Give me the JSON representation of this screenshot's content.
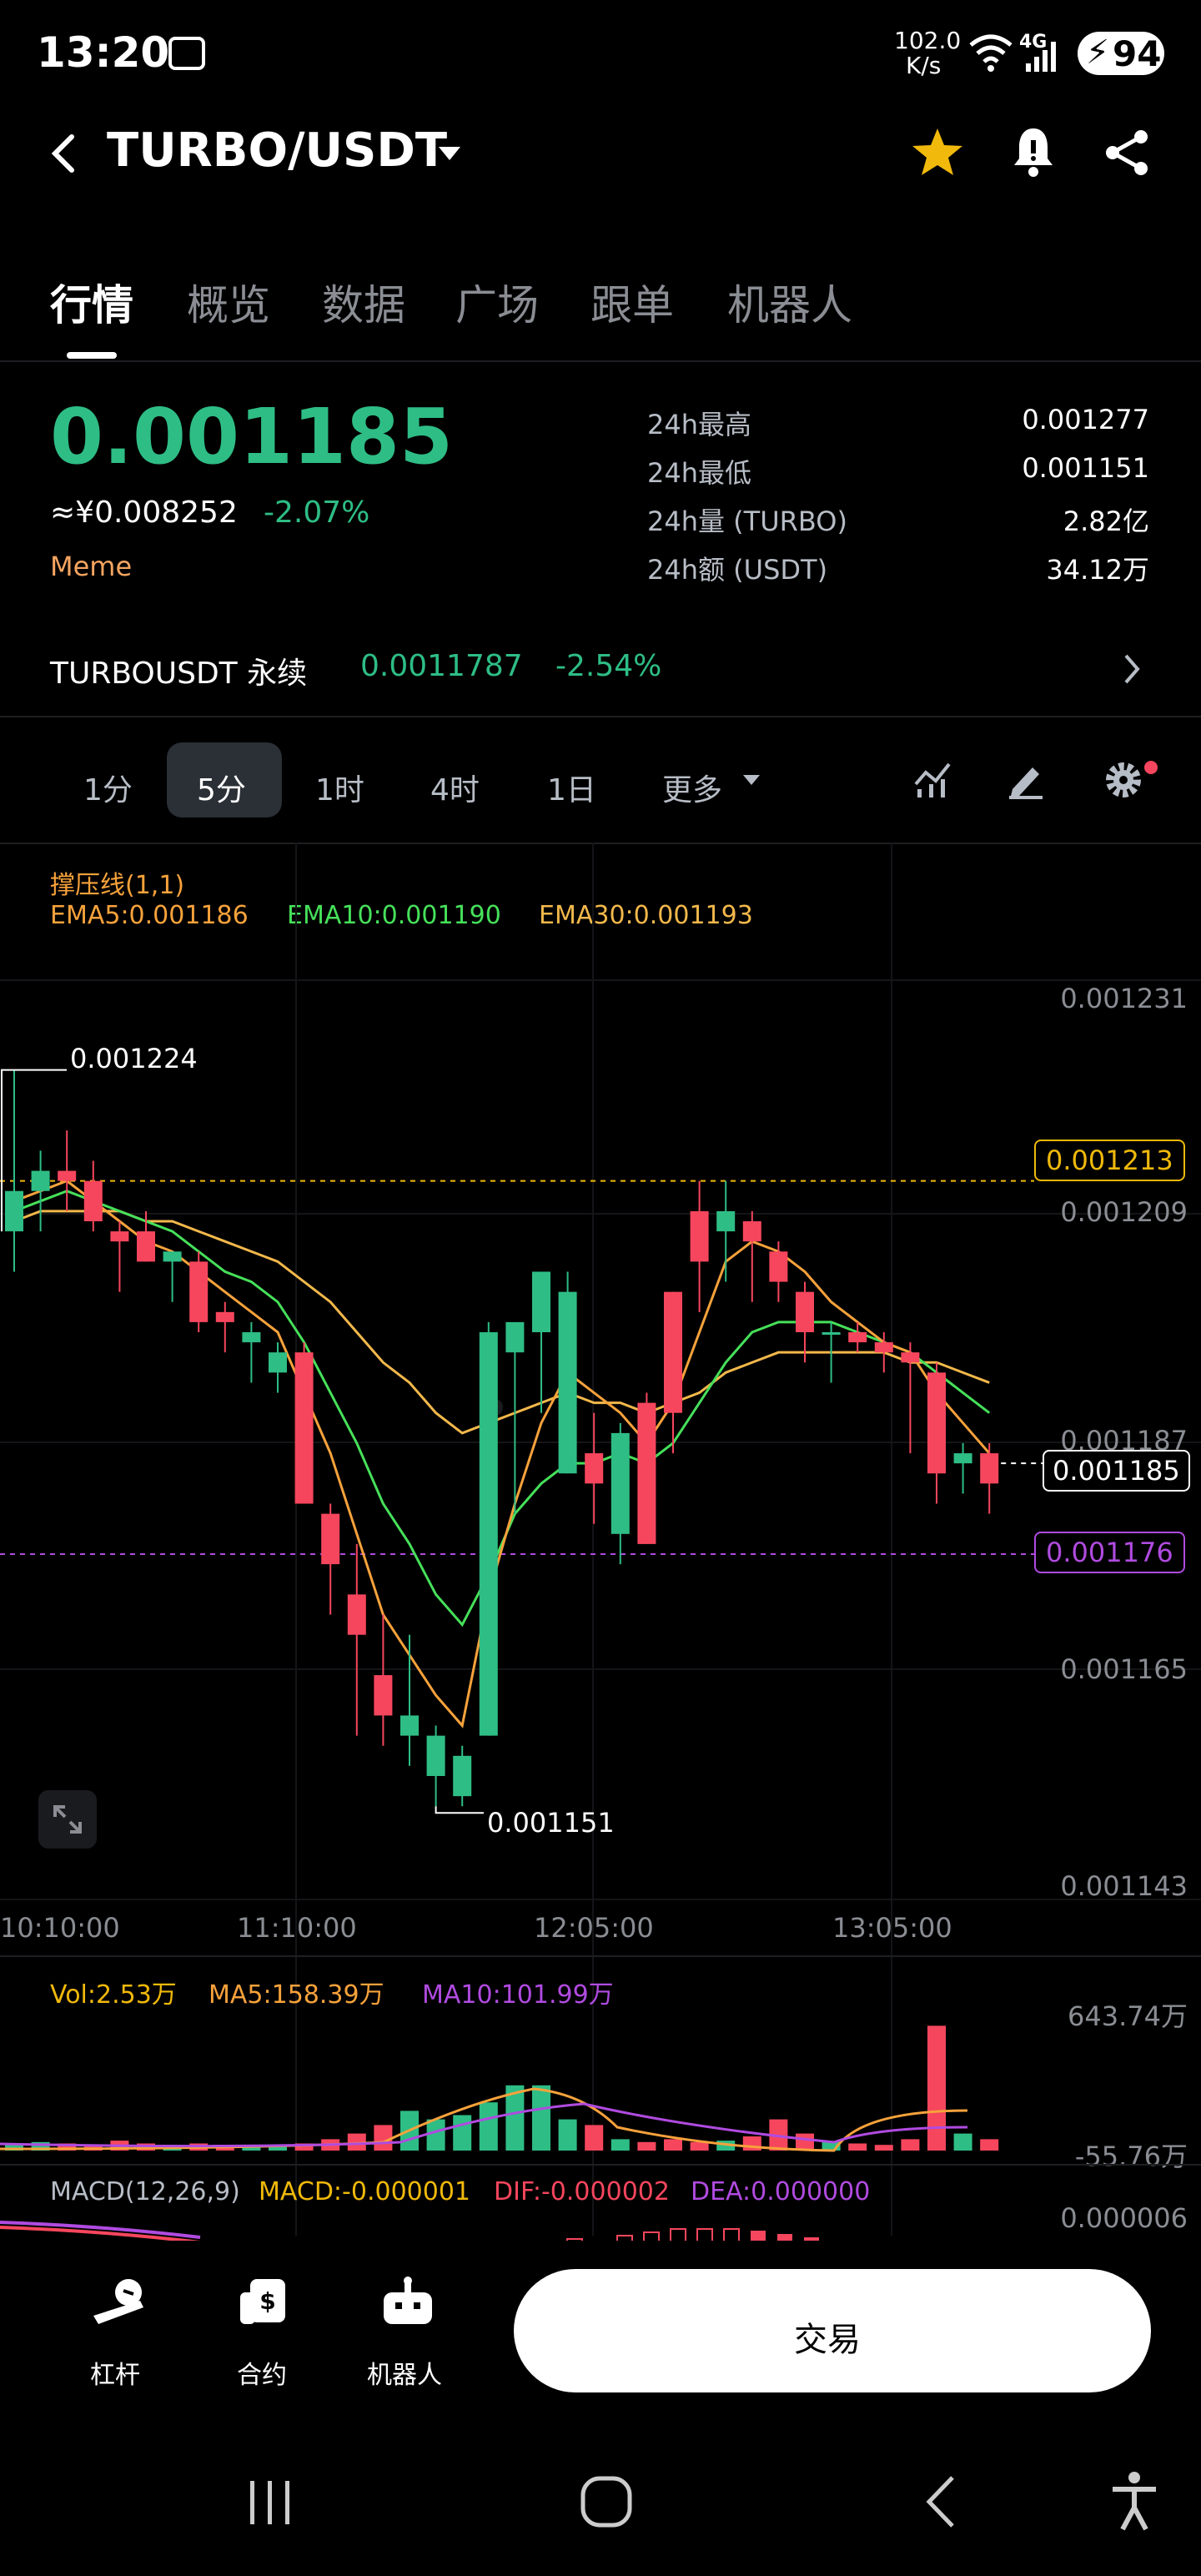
{
  "status_bar": {
    "time": "13:20",
    "net_speed_value": "102.0",
    "net_speed_unit": "K/s",
    "network": "4G",
    "battery": "94"
  },
  "header": {
    "pair": "TURBO/USDT"
  },
  "tabs": [
    "行情",
    "概览",
    "数据",
    "广场",
    "跟单",
    "机器人"
  ],
  "price": {
    "last": "0.001185",
    "cny": "≈¥0.008252",
    "change": "-2.07%",
    "tag": "Meme",
    "stats": [
      {
        "label": "24h最高",
        "value": "0.001277"
      },
      {
        "label": "24h最低",
        "value": "0.001151"
      },
      {
        "label": "24h量 (TURBO)",
        "value": "2.82亿"
      },
      {
        "label": "24h额 (USDT)",
        "value": "34.12万"
      }
    ]
  },
  "perp": {
    "name": "TURBOUSDT 永续",
    "price": "0.0011787",
    "change": "-2.54%"
  },
  "timeframes": [
    "1分",
    "5分",
    "1时",
    "4时",
    "1日",
    "更多"
  ],
  "indicators": {
    "line1": "撑压线(1,1)",
    "ema5": "EMA5:0.001186",
    "ema10": "EMA10:0.001190",
    "ema30": "EMA30:0.001193"
  },
  "chart_data": {
    "type": "candlestick",
    "y_axis_ticks": [
      "0.001231",
      "0.001209",
      "0.001187",
      "0.001165",
      "0.001143"
    ],
    "x_axis_ticks": [
      "10:10:00",
      "11:10:00",
      "12:05:00",
      "13:05:00"
    ],
    "ylim": [
      0.001143,
      0.001231
    ],
    "price_tags": {
      "resistance": "0.001213",
      "last": "0.001185",
      "support": "0.001176"
    },
    "annotations": {
      "high": "0.001224",
      "low": "0.001151"
    },
    "candles": [
      {
        "o": 0.001208,
        "h": 0.001224,
        "l": 0.001204,
        "c": 0.001212
      },
      {
        "o": 0.001212,
        "h": 0.001216,
        "l": 0.001208,
        "c": 0.001214
      },
      {
        "o": 0.001214,
        "h": 0.001218,
        "l": 0.00121,
        "c": 0.001213
      },
      {
        "o": 0.001213,
        "h": 0.001215,
        "l": 0.001208,
        "c": 0.001209
      },
      {
        "o": 0.001208,
        "h": 0.001209,
        "l": 0.001202,
        "c": 0.001207
      },
      {
        "o": 0.001208,
        "h": 0.00121,
        "l": 0.001205,
        "c": 0.001205
      },
      {
        "o": 0.001205,
        "h": 0.001206,
        "l": 0.001201,
        "c": 0.001206
      },
      {
        "o": 0.001205,
        "h": 0.001206,
        "l": 0.001198,
        "c": 0.001199
      },
      {
        "o": 0.0012,
        "h": 0.001201,
        "l": 0.001196,
        "c": 0.001199
      },
      {
        "o": 0.001197,
        "h": 0.001199,
        "l": 0.001193,
        "c": 0.001198
      },
      {
        "o": 0.001194,
        "h": 0.001197,
        "l": 0.001192,
        "c": 0.001196
      },
      {
        "o": 0.001196,
        "h": 0.001197,
        "l": 0.001188,
        "c": 0.001181
      },
      {
        "o": 0.00118,
        "h": 0.001181,
        "l": 0.00117,
        "c": 0.001175
      },
      {
        "o": 0.001172,
        "h": 0.001177,
        "l": 0.001158,
        "c": 0.001168
      },
      {
        "o": 0.001164,
        "h": 0.00117,
        "l": 0.001157,
        "c": 0.00116
      },
      {
        "o": 0.001158,
        "h": 0.001168,
        "l": 0.001155,
        "c": 0.00116
      },
      {
        "o": 0.001154,
        "h": 0.001159,
        "l": 0.001151,
        "c": 0.001158
      },
      {
        "o": 0.001152,
        "h": 0.001157,
        "l": 0.001151,
        "c": 0.001156
      },
      {
        "o": 0.001158,
        "h": 0.001199,
        "l": 0.001158,
        "c": 0.001198
      },
      {
        "o": 0.001196,
        "h": 0.001197,
        "l": 0.00118,
        "c": 0.001199
      },
      {
        "o": 0.001198,
        "h": 0.001204,
        "l": 0.00119,
        "c": 0.001204
      },
      {
        "o": 0.001184,
        "h": 0.001204,
        "l": 0.001184,
        "c": 0.001202
      },
      {
        "o": 0.001186,
        "h": 0.00119,
        "l": 0.001179,
        "c": 0.001183
      },
      {
        "o": 0.001178,
        "h": 0.001189,
        "l": 0.001175,
        "c": 0.001188
      },
      {
        "o": 0.001191,
        "h": 0.001192,
        "l": 0.001177,
        "c": 0.001177
      },
      {
        "o": 0.001202,
        "h": 0.001202,
        "l": 0.001186,
        "c": 0.00119
      },
      {
        "o": 0.00121,
        "h": 0.001213,
        "l": 0.0012,
        "c": 0.001205
      },
      {
        "o": 0.001208,
        "h": 0.001213,
        "l": 0.001203,
        "c": 0.00121
      },
      {
        "o": 0.001209,
        "h": 0.00121,
        "l": 0.001201,
        "c": 0.001207
      },
      {
        "o": 0.001206,
        "h": 0.001207,
        "l": 0.001201,
        "c": 0.001203
      },
      {
        "o": 0.001202,
        "h": 0.001203,
        "l": 0.001195,
        "c": 0.001198
      },
      {
        "o": 0.001198,
        "h": 0.001199,
        "l": 0.001193,
        "c": 0.001198
      },
      {
        "o": 0.001198,
        "h": 0.001199,
        "l": 0.001196,
        "c": 0.001197
      },
      {
        "o": 0.001197,
        "h": 0.001198,
        "l": 0.001194,
        "c": 0.001196
      },
      {
        "o": 0.001196,
        "h": 0.001197,
        "l": 0.001186,
        "c": 0.001195
      },
      {
        "o": 0.001194,
        "h": 0.001195,
        "l": 0.001181,
        "c": 0.001184
      },
      {
        "o": 0.001185,
        "h": 0.001187,
        "l": 0.001182,
        "c": 0.001186
      },
      {
        "o": 0.001186,
        "h": 0.001187,
        "l": 0.00118,
        "c": 0.001183
      }
    ],
    "ema5": [
      0.001211,
      0.001212,
      0.001213,
      0.001211,
      0.001209,
      0.001207,
      0.001206,
      0.001204,
      0.001202,
      0.0012,
      0.001198,
      0.001192,
      0.001186,
      0.001178,
      0.00117,
      0.001166,
      0.001162,
      0.001159,
      0.001172,
      0.001181,
      0.001189,
      0.001194,
      0.001192,
      0.00119,
      0.001187,
      0.001191,
      0.001198,
      0.001205,
      0.001207,
      0.001206,
      0.001204,
      0.001201,
      0.001199,
      0.001197,
      0.001196,
      0.001192,
      0.001189,
      0.001186
    ],
    "ema10": [
      0.00121,
      0.001211,
      0.001212,
      0.001211,
      0.00121,
      0.001209,
      0.001208,
      0.001206,
      0.001204,
      0.001203,
      0.001201,
      0.001197,
      0.001192,
      0.001187,
      0.001181,
      0.001177,
      0.001172,
      0.001169,
      0.001174,
      0.00118,
      0.001183,
      0.001185,
      0.001185,
      0.001186,
      0.001185,
      0.001187,
      0.001191,
      0.001195,
      0.001198,
      0.001199,
      0.001199,
      0.001199,
      0.001198,
      0.001197,
      0.001196,
      0.001194,
      0.001192,
      0.00119
    ],
    "ema30": [
      0.001209,
      0.00121,
      0.00121,
      0.00121,
      0.00121,
      0.001209,
      0.001209,
      0.001208,
      0.001207,
      0.001206,
      0.001205,
      0.001203,
      0.001201,
      0.001198,
      0.001195,
      0.001193,
      0.00119,
      0.001188,
      0.001189,
      0.00119,
      0.001191,
      0.001192,
      0.001191,
      0.001191,
      0.00119,
      0.001191,
      0.001192,
      0.001194,
      0.001195,
      0.001196,
      0.001196,
      0.001196,
      0.001196,
      0.001196,
      0.001195,
      0.001195,
      0.001194,
      0.001193
    ]
  },
  "volume": {
    "vol": "Vol:2.53万",
    "ma5": "MA5:158.39万",
    "ma10": "MA10:101.99万",
    "axis_top": "643.74万",
    "axis_bottom": "-55.76万"
  },
  "macd": {
    "title": "MACD(12,26,9)",
    "macd": "MACD:-0.000001",
    "dif": "DIF:-0.000002",
    "dea": "DEA:0.000000",
    "axis_top": "0.000006"
  },
  "bottom_bar": {
    "leverage": "杠杆",
    "contract": "合约",
    "robot": "机器人",
    "trade": "交易"
  },
  "colors": {
    "up": "#2ebd85",
    "down": "#f6465d",
    "ema5": "#f7a23b",
    "ema10": "#46e05a",
    "ema30": "#f2b84b",
    "accent": "#f0b90b",
    "purple": "#b04be0"
  }
}
